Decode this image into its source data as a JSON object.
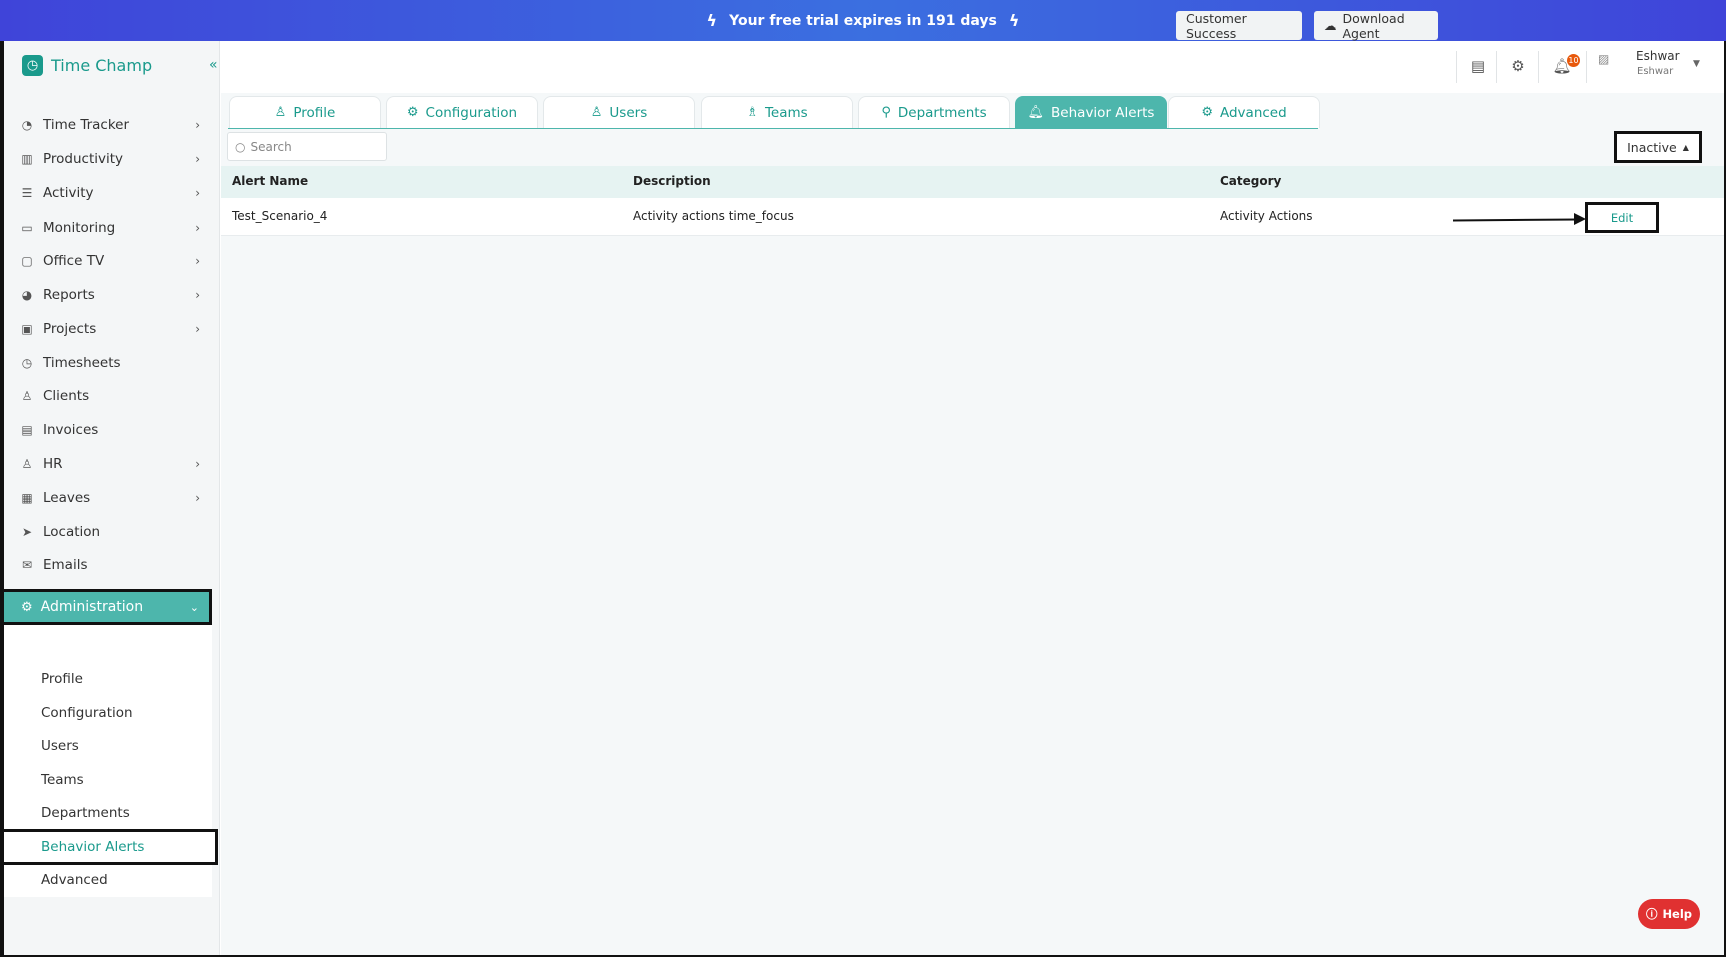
{
  "banner": {
    "text": "Your free trial expires in 191 days",
    "bolt_icon": "lightning-icon"
  },
  "app": {
    "name": "Time Champ"
  },
  "sidebar": {
    "items": [
      {
        "label": "Time Tracker",
        "icon": "clock-icon",
        "chevron": true
      },
      {
        "label": "Productivity",
        "icon": "chart-icon",
        "chevron": true
      },
      {
        "label": "Activity",
        "icon": "activity-icon",
        "chevron": true
      },
      {
        "label": "Monitoring",
        "icon": "monitor-icon",
        "chevron": true
      },
      {
        "label": "Office TV",
        "icon": "tv-icon",
        "chevron": true
      },
      {
        "label": "Reports",
        "icon": "pie-icon",
        "chevron": true
      },
      {
        "label": "Projects",
        "icon": "briefcase-icon",
        "chevron": true
      },
      {
        "label": "Timesheets",
        "icon": "alarm-icon",
        "chevron": false
      },
      {
        "label": "Clients",
        "icon": "client-icon",
        "chevron": false
      },
      {
        "label": "Invoices",
        "icon": "invoice-icon",
        "chevron": false
      },
      {
        "label": "HR",
        "icon": "person-icon",
        "chevron": true
      },
      {
        "label": "Leaves",
        "icon": "calendar-icon",
        "chevron": true
      },
      {
        "label": "Location",
        "icon": "location-icon",
        "chevron": false
      },
      {
        "label": "Emails",
        "icon": "mail-icon",
        "chevron": false
      }
    ],
    "admin": {
      "label": "Administration"
    },
    "submenu": [
      "Profile",
      "Configuration",
      "Users",
      "Teams",
      "Departments",
      "Behavior Alerts",
      "Advanced"
    ],
    "active_sub": "Behavior Alerts"
  },
  "header": {
    "customer_success": "Customer Success",
    "download_agent": "Download Agent",
    "notification_count": "10",
    "user_name": "Eshwar",
    "user_sub": "Eshwar"
  },
  "tabs": [
    "Profile",
    "Configuration",
    "Users",
    "Teams",
    "Departments",
    "Behavior Alerts",
    "Advanced"
  ],
  "active_tab": "Behavior Alerts",
  "search": {
    "placeholder": "Search",
    "value": ""
  },
  "status_filter": {
    "label": "Inactive"
  },
  "table": {
    "columns": [
      "Alert Name",
      "Description",
      "Category"
    ],
    "rows": [
      {
        "name": "Test_Scenario_4",
        "description": "Activity actions time_focus",
        "category": "Activity Actions",
        "action": "Edit"
      }
    ]
  },
  "help": {
    "label": "Help"
  },
  "colors": {
    "accent": "#4db6ac",
    "brand": "#1a9a8c",
    "banner": "#3f44d9",
    "help": "#e03131",
    "badge": "#e8590c"
  }
}
